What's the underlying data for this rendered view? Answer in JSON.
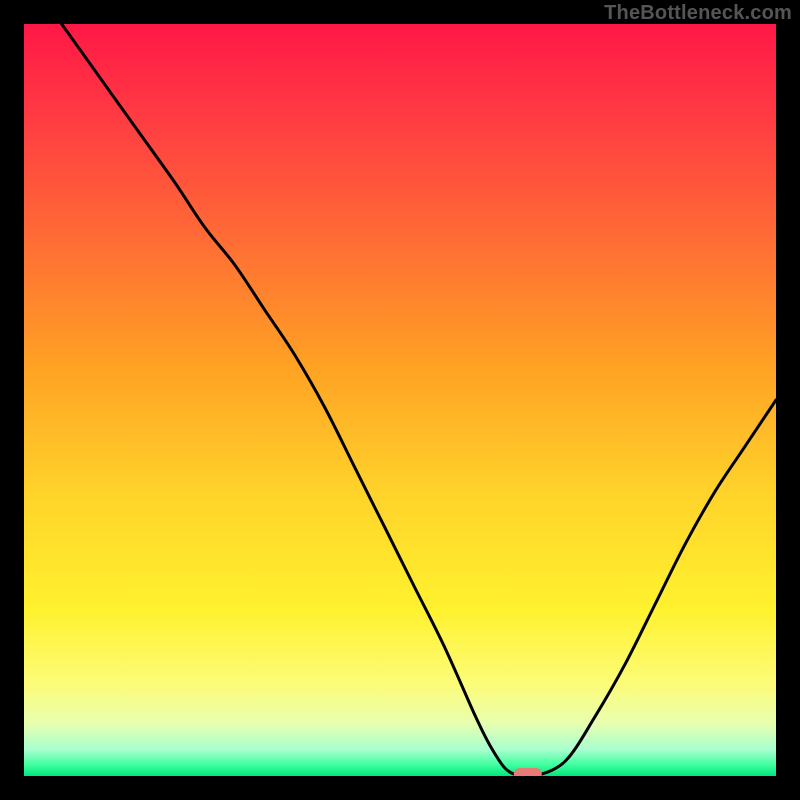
{
  "watermark": "TheBottleneck.com",
  "colors": {
    "background": "#000000",
    "curve": "#000000",
    "marker_fill": "#e77b75",
    "gradient_stops": [
      {
        "offset": 0.0,
        "color": "#ff1846"
      },
      {
        "offset": 0.12,
        "color": "#ff3a43"
      },
      {
        "offset": 0.28,
        "color": "#ff6a36"
      },
      {
        "offset": 0.45,
        "color": "#ffa024"
      },
      {
        "offset": 0.62,
        "color": "#ffd22a"
      },
      {
        "offset": 0.78,
        "color": "#fff22f"
      },
      {
        "offset": 0.88,
        "color": "#fcfc7a"
      },
      {
        "offset": 0.93,
        "color": "#e8ffb0"
      },
      {
        "offset": 0.965,
        "color": "#a8ffcf"
      },
      {
        "offset": 0.985,
        "color": "#40ffa0"
      },
      {
        "offset": 1.0,
        "color": "#00e67a"
      }
    ]
  },
  "chart_data": {
    "type": "line",
    "title": "",
    "xlabel": "",
    "ylabel": "",
    "xlim": [
      0,
      100
    ],
    "ylim": [
      0,
      100
    ],
    "grid": false,
    "legend": false,
    "series": [
      {
        "name": "bottleneck-curve",
        "x": [
          5,
          10,
          15,
          20,
          24,
          28,
          32,
          36,
          40,
          44,
          48,
          52,
          56,
          60,
          62,
          64,
          66,
          68,
          72,
          76,
          80,
          84,
          88,
          92,
          96,
          100
        ],
        "y": [
          100,
          93,
          86,
          79,
          73,
          68,
          62,
          56,
          49,
          41,
          33,
          25,
          17,
          8,
          4,
          1,
          0,
          0,
          2,
          8,
          15,
          23,
          31,
          38,
          44,
          50
        ]
      }
    ],
    "annotations": [
      {
        "name": "optimum-marker",
        "x": 67,
        "y": 0,
        "shape": "pill"
      }
    ]
  }
}
